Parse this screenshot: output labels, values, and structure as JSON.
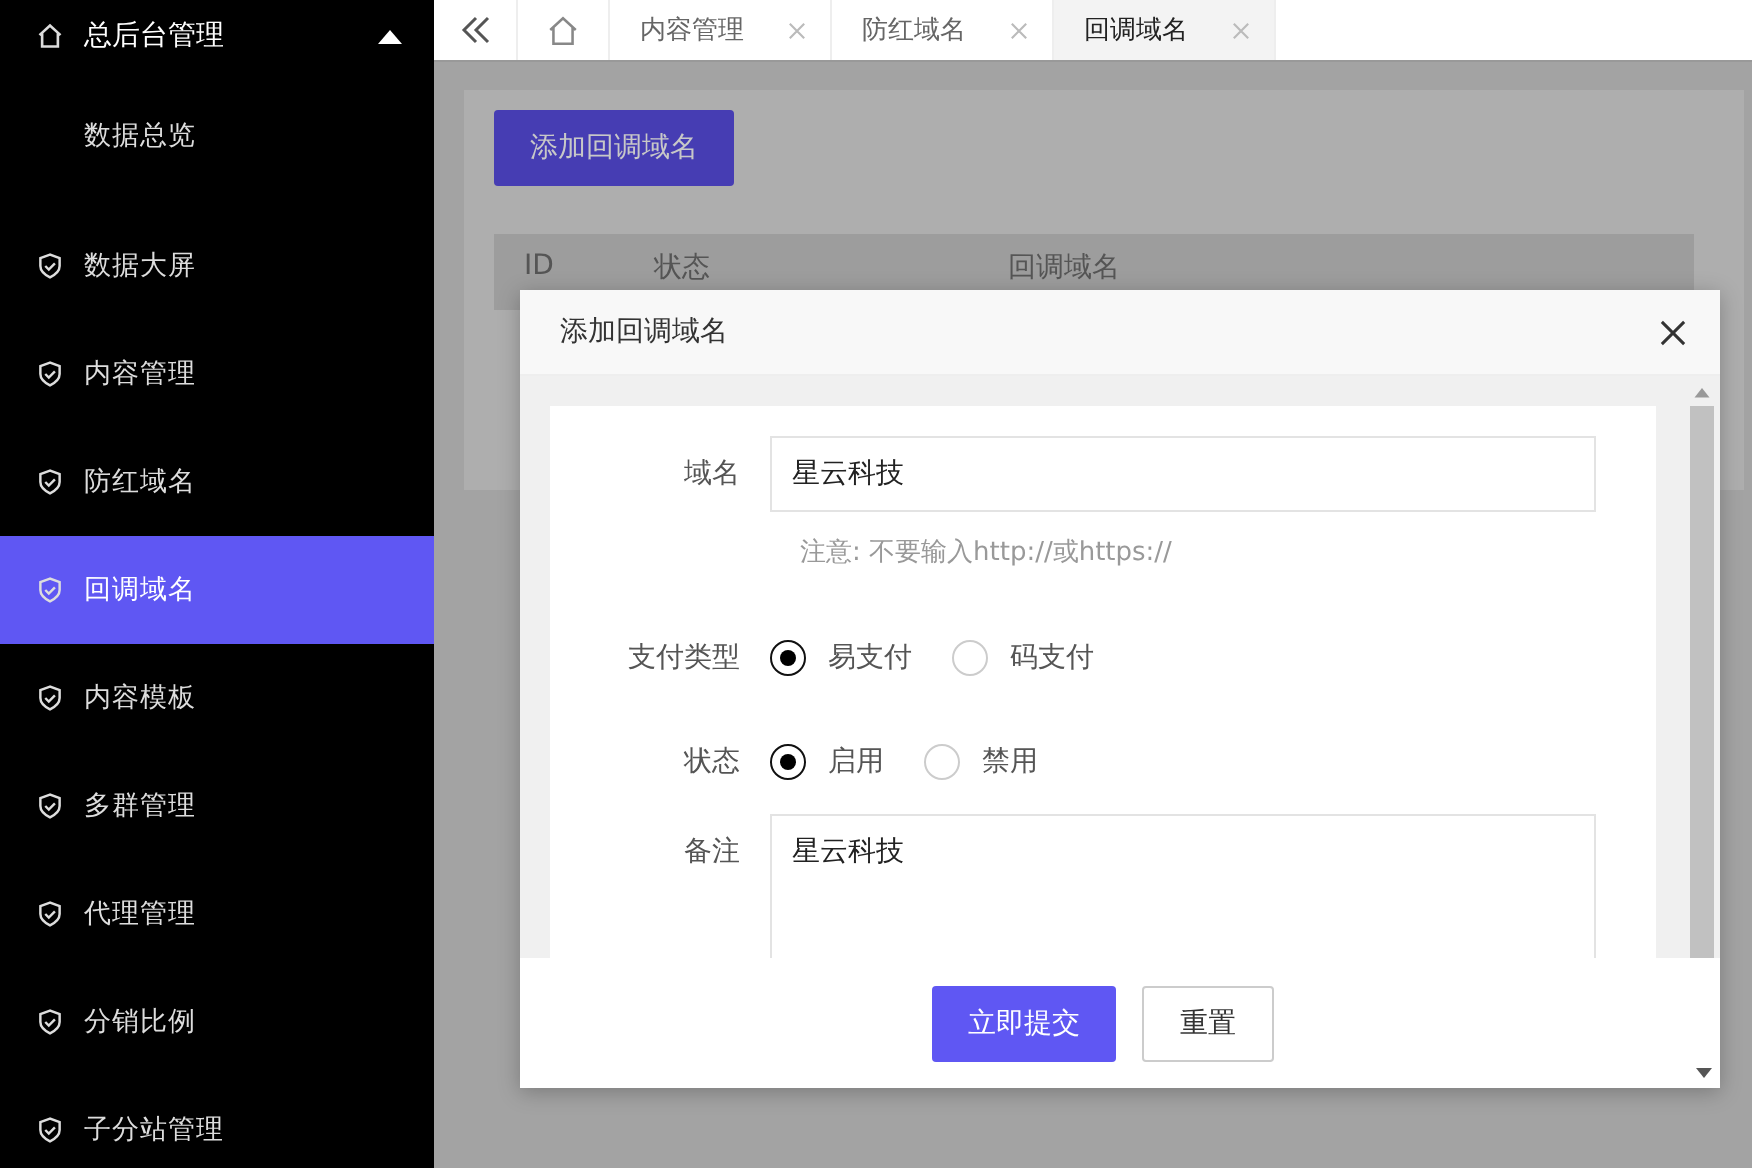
{
  "sidebar": {
    "header": {
      "label": "总后台管理",
      "expanded": true
    },
    "items": [
      {
        "label": "数据总览",
        "kind": "sub",
        "selected": false
      },
      {
        "label": "数据大屏",
        "kind": "item",
        "selected": false
      },
      {
        "label": "内容管理",
        "kind": "item",
        "selected": false
      },
      {
        "label": "防红域名",
        "kind": "item",
        "selected": false
      },
      {
        "label": "回调域名",
        "kind": "item",
        "selected": true
      },
      {
        "label": "内容模板",
        "kind": "item",
        "selected": false
      },
      {
        "label": "多群管理",
        "kind": "item",
        "selected": false
      },
      {
        "label": "代理管理",
        "kind": "item",
        "selected": false
      },
      {
        "label": "分销比例",
        "kind": "item",
        "selected": false
      },
      {
        "label": "子分站管理",
        "kind": "item",
        "selected": false
      }
    ]
  },
  "tabs": [
    {
      "label": "内容管理",
      "selected": false
    },
    {
      "label": "防红域名",
      "selected": false
    },
    {
      "label": "回调域名",
      "selected": true
    }
  ],
  "page": {
    "add_button": "添加回调域名",
    "table_columns": [
      "ID",
      "状态",
      "回调域名"
    ]
  },
  "dialog": {
    "title": "添加回调域名",
    "domain": {
      "label": "域名",
      "value": "星云科技",
      "hint": "注意: 不要输入http://或https://"
    },
    "pay_type": {
      "label": "支付类型",
      "options": [
        {
          "label": "易支付",
          "selected": true
        },
        {
          "label": "码支付",
          "selected": false
        }
      ]
    },
    "status": {
      "label": "状态",
      "options": [
        {
          "label": "启用",
          "selected": true
        },
        {
          "label": "禁用",
          "selected": false
        }
      ]
    },
    "remark": {
      "label": "备注",
      "value": "星云科技"
    },
    "submit": "立即提交",
    "reset": "重置"
  }
}
